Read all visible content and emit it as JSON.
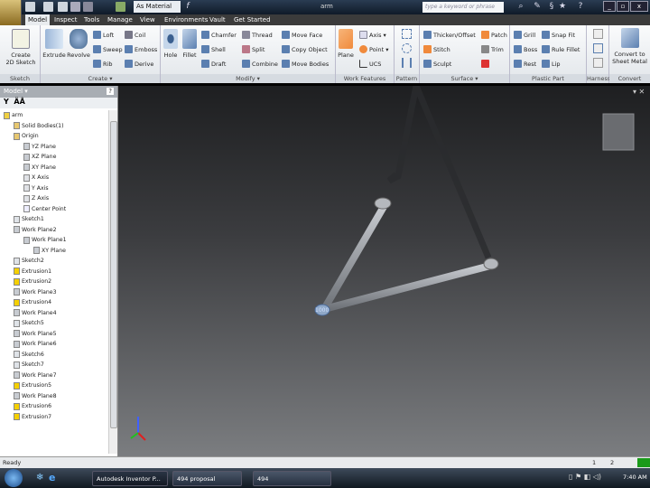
{
  "titlebar": {
    "material": "As Material",
    "document_title": "arm",
    "search_placeholder": "type a keyword or phrase"
  },
  "tabs": [
    "Model",
    "Inspect",
    "Tools",
    "Manage",
    "View",
    "Environments",
    "Vault",
    "Get Started"
  ],
  "ribbon": {
    "sketch": {
      "label": "Sketch",
      "create": "Create",
      "sketch2d": "2D Sketch"
    },
    "create": {
      "label": "Create ▾",
      "extrude": "Extrude",
      "revolve": "Revolve",
      "loft": "Loft",
      "sweep": "Sweep",
      "rib": "Rib",
      "coil": "Coil",
      "emboss": "Emboss",
      "derive": "Derive"
    },
    "modify": {
      "label": "Modify ▾",
      "hole": "Hole",
      "fillet": "Fillet",
      "chamfer": "Chamfer",
      "shell": "Shell",
      "draft": "Draft",
      "thread": "Thread",
      "split": "Split",
      "combine": "Combine",
      "move_face": "Move Face",
      "copy_object": "Copy Object",
      "move_bodies": "Move Bodies"
    },
    "work_features": {
      "label": "Work Features",
      "plane": "Plane",
      "axis": "Axis ▾",
      "point": "Point ▾",
      "ucs": "UCS"
    },
    "pattern": {
      "label": "Pattern"
    },
    "surface": {
      "label": "Surface ▾",
      "thicken": "Thicken/Offset",
      "stitch": "Stitch",
      "sculpt": "Sculpt",
      "patch": "Patch",
      "trim": "Trim"
    },
    "plastic_part": {
      "label": "Plastic Part",
      "grill": "Grill",
      "boss": "Boss",
      "rest": "Rest",
      "snap_fit": "Snap Fit",
      "rule_fillet": "Rule Fillet",
      "lip": "Lip"
    },
    "harness": {
      "label": "Harness"
    },
    "convert": {
      "label": "Convert",
      "convert_to": "Convert to",
      "sheet_metal": "Sheet Metal"
    }
  },
  "browser": {
    "title": "Model ▾",
    "items": [
      {
        "label": "arm",
        "indent": 0,
        "icon": "part"
      },
      {
        "label": "Solid Bodies(1)",
        "indent": 1,
        "icon": "folder"
      },
      {
        "label": "Origin",
        "indent": 1,
        "icon": "folder"
      },
      {
        "label": "YZ Plane",
        "indent": 2,
        "icon": "plane"
      },
      {
        "label": "XZ Plane",
        "indent": 2,
        "icon": "plane"
      },
      {
        "label": "XY Plane",
        "indent": 2,
        "icon": "plane"
      },
      {
        "label": "X Axis",
        "indent": 2,
        "icon": "axis"
      },
      {
        "label": "Y Axis",
        "indent": 2,
        "icon": "axis"
      },
      {
        "label": "Z Axis",
        "indent": 2,
        "icon": "axis"
      },
      {
        "label": "Center Point",
        "indent": 2,
        "icon": "point"
      },
      {
        "label": "Sketch1",
        "indent": 1,
        "icon": "sketch"
      },
      {
        "label": "Work Plane2",
        "indent": 1,
        "icon": "plane"
      },
      {
        "label": "Work Plane1",
        "indent": 2,
        "icon": "plane"
      },
      {
        "label": "XY Plane",
        "indent": 3,
        "icon": "plane"
      },
      {
        "label": "Sketch2",
        "indent": 1,
        "icon": "sketch"
      },
      {
        "label": "Extrusion1",
        "indent": 1,
        "icon": "extrude"
      },
      {
        "label": "Extrusion2",
        "indent": 1,
        "icon": "extrude"
      },
      {
        "label": "Work Plane3",
        "indent": 1,
        "icon": "plane"
      },
      {
        "label": "Extrusion4",
        "indent": 1,
        "icon": "extrude"
      },
      {
        "label": "Work Plane4",
        "indent": 1,
        "icon": "plane"
      },
      {
        "label": "Sketch5",
        "indent": 1,
        "icon": "sketch"
      },
      {
        "label": "Work Plane5",
        "indent": 1,
        "icon": "plane"
      },
      {
        "label": "Work Plane6",
        "indent": 1,
        "icon": "plane"
      },
      {
        "label": "Sketch6",
        "indent": 1,
        "icon": "sketch"
      },
      {
        "label": "Sketch7",
        "indent": 1,
        "icon": "sketch"
      },
      {
        "label": "Work Plane7",
        "indent": 1,
        "icon": "plane"
      },
      {
        "label": "Extrusion5",
        "indent": 1,
        "icon": "extrude"
      },
      {
        "label": "Work Plane8",
        "indent": 1,
        "icon": "plane"
      },
      {
        "label": "Extrusion6",
        "indent": 1,
        "icon": "extrude"
      },
      {
        "label": "Extrusion7",
        "indent": 1,
        "icon": "extrude"
      }
    ]
  },
  "viewport": {
    "label_1000": "1000"
  },
  "status": {
    "text": "Ready",
    "page1": "1",
    "page2": "2"
  },
  "taskbar": {
    "tasks": [
      "Autodesk Inventor P...",
      "494 proposal",
      "494"
    ],
    "clock": "7:40 AM"
  }
}
